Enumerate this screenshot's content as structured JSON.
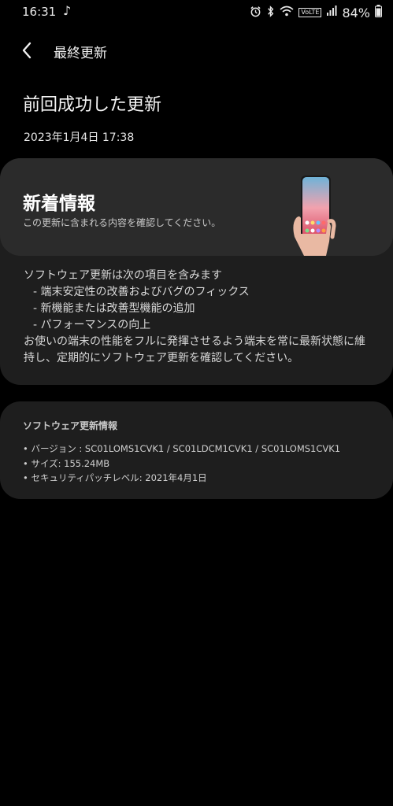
{
  "status_bar": {
    "time": "16:31",
    "note_glyph": "♪",
    "battery": "84%",
    "lte": "VoLTE"
  },
  "app_bar": {
    "back_icon": "chevron-left-icon",
    "title": "最終更新"
  },
  "page": {
    "title": "前回成功した更新",
    "date": "2023年1月4日 17:38"
  },
  "whats_new": {
    "title": "新着情報",
    "subtitle": "この更新に含まれる内容を確認してください。",
    "intro": "ソフトウェア更新は次の項目を含みます",
    "items": [
      "- 端末安定性の改善およびバグのフィックス",
      "- 新機能または改善型機能の追加",
      "- パフォーマンスの向上"
    ],
    "outro_1": "お使いの端末の性能をフルに発揮させるよう端末を常に最新状態に維",
    "outro_2": "持し、定期的にソフトウェア更新を確認してください。"
  },
  "software_info": {
    "title": "ソフトウェア更新情報",
    "lines": [
      "• バージョン : SC01LOMS1CVK1 / SC01LDCM1CVK1 / SC01LOMS1CVK1",
      "• サイズ: 155.24MB",
      "• セキュリティパッチレベル: 2021年4月1日"
    ]
  },
  "colors": {
    "background": "#000000",
    "card": "#1e1e1e",
    "card_header": "#2b2b2b"
  }
}
